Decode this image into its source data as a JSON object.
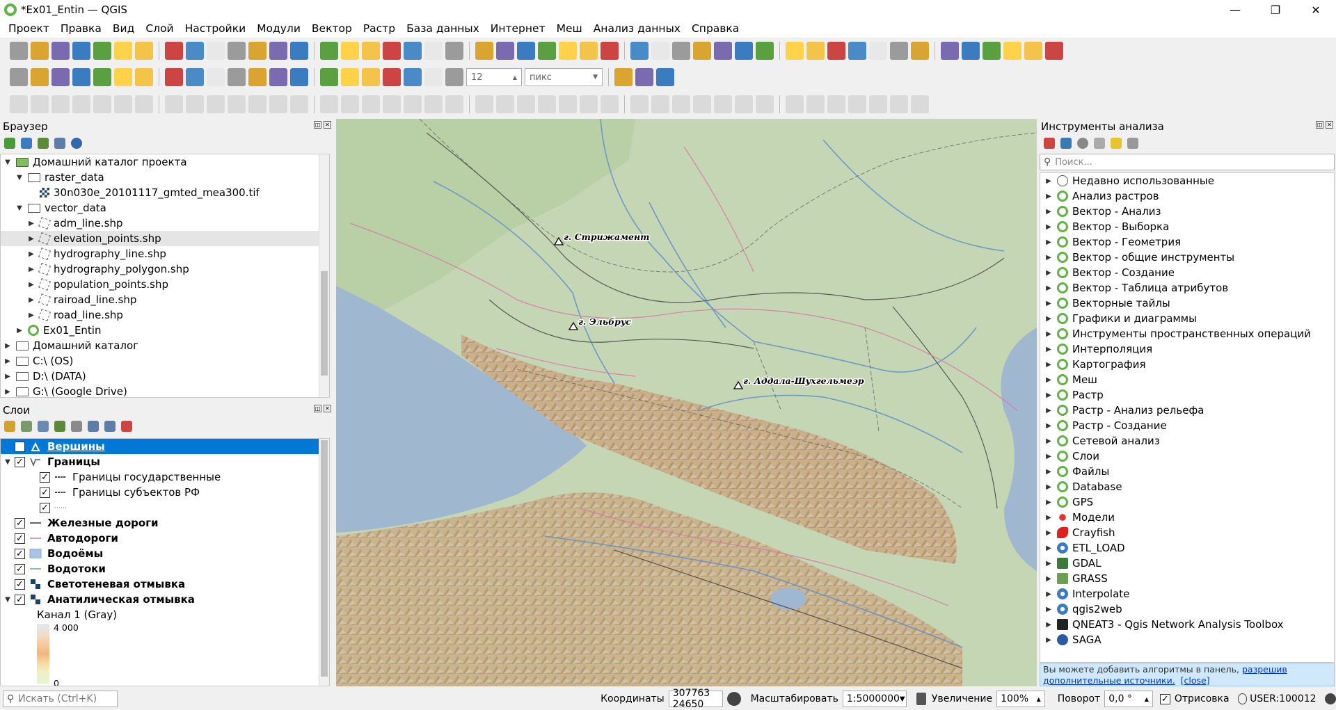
{
  "window": {
    "title": "*Ex01_Entin — QGIS",
    "minimize": "—",
    "maximize": "❐",
    "close": "✕"
  },
  "menu": [
    "Проект",
    "Правка",
    "Вид",
    "Слой",
    "Настройки",
    "Модули",
    "Вектор",
    "Растр",
    "База данных",
    "Интернет",
    "Меш",
    "Анализ данных",
    "Справка"
  ],
  "label_toolbar": {
    "size_value": "12",
    "size_unit": "пикс"
  },
  "browser": {
    "title": "Браузер",
    "items": [
      {
        "label": "Домашний каталог проекта",
        "indent": 0,
        "arrow": "▼",
        "icon": "home-folder"
      },
      {
        "label": "raster_data",
        "indent": 1,
        "arrow": "▼",
        "icon": "folder"
      },
      {
        "label": "30n030e_20101117_gmted_mea300.tif",
        "indent": 2,
        "arrow": "",
        "icon": "raster"
      },
      {
        "label": "vector_data",
        "indent": 1,
        "arrow": "▼",
        "icon": "folder"
      },
      {
        "label": "adm_line.shp",
        "indent": 2,
        "arrow": "▶",
        "icon": "shp"
      },
      {
        "label": "elevation_points.shp",
        "indent": 2,
        "arrow": "▶",
        "icon": "shp",
        "hover": true
      },
      {
        "label": "hydrography_line.shp",
        "indent": 2,
        "arrow": "▶",
        "icon": "shp"
      },
      {
        "label": "hydrography_polygon.shp",
        "indent": 2,
        "arrow": "▶",
        "icon": "shp"
      },
      {
        "label": "population_points.shp",
        "indent": 2,
        "arrow": "▶",
        "icon": "shp"
      },
      {
        "label": "rairoad_line.shp",
        "indent": 2,
        "arrow": "▶",
        "icon": "shp"
      },
      {
        "label": "road_line.shp",
        "indent": 2,
        "arrow": "▶",
        "icon": "shp"
      },
      {
        "label": "Ex01_Entin",
        "indent": 1,
        "arrow": "▶",
        "icon": "qgis"
      },
      {
        "label": "Домашний каталог",
        "indent": 0,
        "arrow": "▶",
        "icon": "home-folder"
      },
      {
        "label": "C:\\ (OS)",
        "indent": 0,
        "arrow": "▶",
        "icon": "folder"
      },
      {
        "label": "D:\\ (DATA)",
        "indent": 0,
        "arrow": "▶",
        "icon": "folder"
      },
      {
        "label": "G:\\ (Google Drive)",
        "indent": 0,
        "arrow": "▶",
        "icon": "folder"
      }
    ]
  },
  "layers": {
    "title": "Слои",
    "items": [
      {
        "label": "Вершины",
        "indent": 0,
        "arrow": "",
        "bold": true,
        "selected": true,
        "symbol": "triangle"
      },
      {
        "label": "Границы",
        "indent": 0,
        "arrow": "▼",
        "bold": true,
        "symbol": "lines"
      },
      {
        "label": "Границы государственные",
        "indent": 1,
        "arrow": "",
        "bold": false,
        "symbol": "dash-dark"
      },
      {
        "label": "Границы субъектов РФ",
        "indent": 1,
        "arrow": "",
        "bold": false,
        "symbol": "dash-dark"
      },
      {
        "label": "",
        "indent": 1,
        "arrow": "",
        "bold": false,
        "symbol": "dots"
      },
      {
        "label": "Железные дороги",
        "indent": 0,
        "arrow": "",
        "bold": true,
        "symbol": "line-dark"
      },
      {
        "label": "Автодороги",
        "indent": 0,
        "arrow": "",
        "bold": true,
        "symbol": "line-pink"
      },
      {
        "label": "Водоёмы",
        "indent": 0,
        "arrow": "",
        "bold": true,
        "symbol": "fill-blue"
      },
      {
        "label": "Водотоки",
        "indent": 0,
        "arrow": "",
        "bold": true,
        "symbol": "line-blue"
      },
      {
        "label": "Светотеневая отмывка",
        "indent": 0,
        "arrow": "",
        "bold": true,
        "symbol": "raster"
      },
      {
        "label": "Анатилическая отмывка",
        "indent": 0,
        "arrow": "▼",
        "bold": true,
        "symbol": "raster"
      }
    ],
    "band_label": "Канал 1 (Gray)",
    "ramp_max": "4 000",
    "ramp_min": "0"
  },
  "processing": {
    "title": "Инструменты анализа",
    "search_placeholder": "Поиск...",
    "items": [
      {
        "label": "Недавно использованные",
        "icon": "clock"
      },
      {
        "label": "Анализ растров",
        "icon": "qgis"
      },
      {
        "label": "Вектор - Анализ",
        "icon": "qgis"
      },
      {
        "label": "Вектор - Выборка",
        "icon": "qgis"
      },
      {
        "label": "Вектор - Геометрия",
        "icon": "qgis"
      },
      {
        "label": "Вектор - общие инструменты",
        "icon": "qgis"
      },
      {
        "label": "Вектор - Создание",
        "icon": "qgis"
      },
      {
        "label": "Вектор - Таблица атрибутов",
        "icon": "qgis"
      },
      {
        "label": "Векторные тайлы",
        "icon": "qgis"
      },
      {
        "label": "Графики и диаграммы",
        "icon": "qgis"
      },
      {
        "label": "Инструменты пространственных операций",
        "icon": "qgis"
      },
      {
        "label": "Интерполяция",
        "icon": "qgis"
      },
      {
        "label": "Картография",
        "icon": "qgis"
      },
      {
        "label": "Меш",
        "icon": "qgis"
      },
      {
        "label": "Растр",
        "icon": "qgis"
      },
      {
        "label": "Растр - Анализ рельефа",
        "icon": "qgis"
      },
      {
        "label": "Растр - Создание",
        "icon": "qgis"
      },
      {
        "label": "Сетевой анализ",
        "icon": "qgis"
      },
      {
        "label": "Слои",
        "icon": "qgis"
      },
      {
        "label": "Файлы",
        "icon": "qgis"
      },
      {
        "label": "Database",
        "icon": "qgis"
      },
      {
        "label": "GPS",
        "icon": "qgis"
      },
      {
        "label": "Модели",
        "icon": "gears"
      },
      {
        "label": "Crayfish",
        "icon": "crayfish"
      },
      {
        "label": "ETL_LOAD",
        "icon": "gear"
      },
      {
        "label": "GDAL",
        "icon": "gdal"
      },
      {
        "label": "GRASS",
        "icon": "grass"
      },
      {
        "label": "Interpolate",
        "icon": "gear"
      },
      {
        "label": "qgis2web",
        "icon": "gear"
      },
      {
        "label": "QNEAT3 - Qgis Network Analysis Toolbox",
        "icon": "qneat"
      },
      {
        "label": "SAGA",
        "icon": "saga"
      }
    ],
    "info_text": "Вы можете добавить алгоритмы в панель,",
    "info_link": "разрешив дополнительные источники.",
    "info_close": "[close]"
  },
  "map_labels": [
    {
      "text": "г. Стрижамент"
    },
    {
      "text": "г. Эльбрус"
    },
    {
      "text": "г. Аддала-Шухгельмеэр"
    }
  ],
  "status": {
    "search_placeholder": "Искать (Ctrl+K)",
    "coords_label": "Координаты",
    "coords_value": "307763 24650",
    "scale_label": "Масштабировать",
    "scale_value": "1:5000000",
    "magnifier_label": "Увеличение",
    "magnifier_value": "100%",
    "rotation_label": "Поворот",
    "rotation_value": "0,0 °",
    "render_label": "Отрисовка",
    "crs_label": "USER:100012"
  },
  "colors": {
    "accent": "#0078d7",
    "qgis_green": "#62b347",
    "info_bg": "#cfe8fc"
  }
}
